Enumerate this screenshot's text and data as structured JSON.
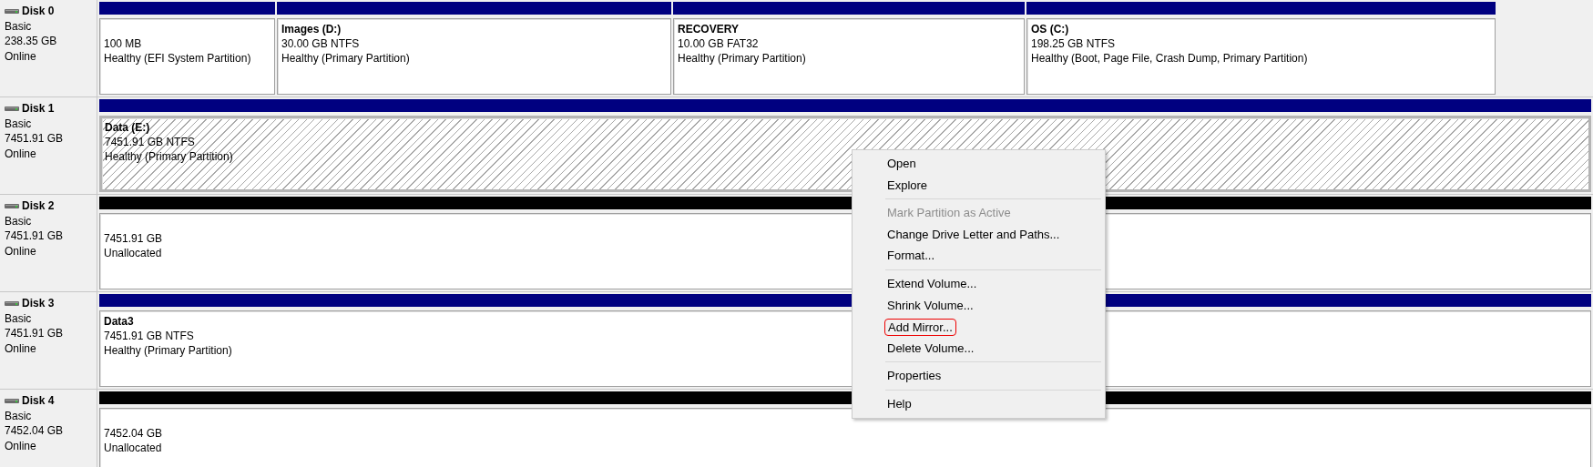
{
  "disks": [
    {
      "name": "Disk 0",
      "type": "Basic",
      "size": "238.35 GB",
      "status": "Online",
      "partitions": [
        {
          "size": "100 MB",
          "status": "Healthy (EFI System Partition)",
          "kind": "primary",
          "selected": false
        },
        {
          "label": "Images  (D:)",
          "size": "30.00 GB NTFS",
          "status": "Healthy (Primary Partition)",
          "kind": "primary",
          "selected": false
        },
        {
          "label": "RECOVERY",
          "size": "10.00 GB FAT32",
          "status": "Healthy (Primary Partition)",
          "kind": "primary",
          "selected": false
        },
        {
          "label": "OS  (C:)",
          "size": "198.25 GB NTFS",
          "status": "Healthy (Boot, Page File, Crash Dump, Primary Partition)",
          "kind": "primary",
          "selected": false
        }
      ]
    },
    {
      "name": "Disk 1",
      "type": "Basic",
      "size": "7451.91 GB",
      "status": "Online",
      "partitions": [
        {
          "label": "Data  (E:)",
          "size": "7451.91 GB NTFS",
          "status": "Healthy (Primary Partition)",
          "kind": "primary",
          "selected": true
        }
      ]
    },
    {
      "name": "Disk 2",
      "type": "Basic",
      "size": "7451.91 GB",
      "status": "Online",
      "partitions": [
        {
          "size": "7451.91 GB",
          "status": "Unallocated",
          "kind": "unallocated",
          "selected": false
        }
      ]
    },
    {
      "name": "Disk 3",
      "type": "Basic",
      "size": "7451.91 GB",
      "status": "Online",
      "partitions": [
        {
          "label": "Data3",
          "size": "7451.91 GB NTFS",
          "status": "Healthy (Primary Partition)",
          "kind": "primary",
          "selected": false
        }
      ]
    },
    {
      "name": "Disk 4",
      "type": "Basic",
      "size": "7452.04 GB",
      "status": "Online",
      "partitions": [
        {
          "size": "7452.04 GB",
          "status": "Unallocated",
          "kind": "unallocated",
          "selected": false
        }
      ]
    }
  ],
  "context_menu": [
    {
      "kind": "item",
      "label": "Open",
      "disabled": false,
      "outlined": false
    },
    {
      "kind": "item",
      "label": "Explore",
      "disabled": false,
      "outlined": false
    },
    {
      "kind": "separator"
    },
    {
      "kind": "item",
      "label": "Mark Partition as Active",
      "disabled": true,
      "outlined": false
    },
    {
      "kind": "item",
      "label": "Change Drive Letter and Paths...",
      "disabled": false,
      "outlined": false
    },
    {
      "kind": "item",
      "label": "Format...",
      "disabled": false,
      "outlined": false
    },
    {
      "kind": "separator"
    },
    {
      "kind": "item",
      "label": "Extend Volume...",
      "disabled": false,
      "outlined": false
    },
    {
      "kind": "item",
      "label": "Shrink Volume...",
      "disabled": false,
      "outlined": false
    },
    {
      "kind": "item",
      "label": "Add Mirror...",
      "disabled": false,
      "outlined": true
    },
    {
      "kind": "item",
      "label": "Delete Volume...",
      "disabled": false,
      "outlined": false
    },
    {
      "kind": "separator"
    },
    {
      "kind": "item",
      "label": "Properties",
      "disabled": false,
      "outlined": false
    },
    {
      "kind": "separator"
    },
    {
      "kind": "item",
      "label": "Help",
      "disabled": false,
      "outlined": false
    }
  ]
}
